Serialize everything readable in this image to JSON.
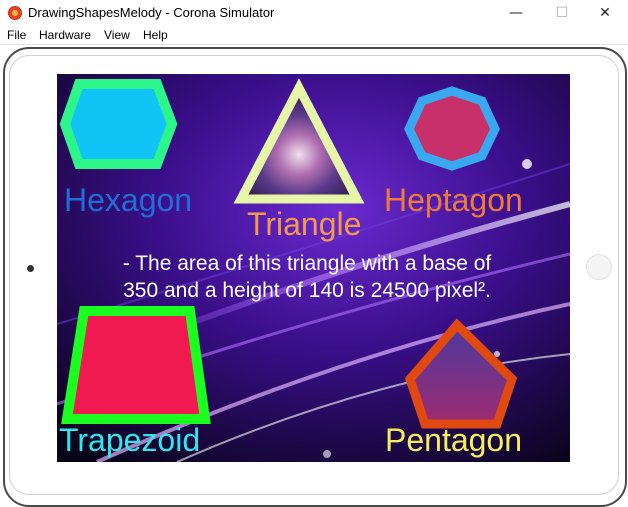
{
  "window": {
    "title": "DrawingShapesMelody - Corona Simulator",
    "controls": {
      "minimize": "—",
      "maximize": "☐",
      "close": "✕"
    }
  },
  "menu": [
    "File",
    "Hardware",
    "View",
    "Help"
  ],
  "scene": {
    "shapes": [
      {
        "name": "hexagon",
        "label": "Hexagon",
        "label_color": "#1f6fd6",
        "fill": "#12c3f5",
        "stroke": "#2cf58a"
      },
      {
        "name": "triangle",
        "label": "Triangle",
        "label_color": "#f59a4a",
        "fill": "nebula-image",
        "stroke": "#e6f5a8"
      },
      {
        "name": "heptagon",
        "label": "Heptagon",
        "label_color": "#f07a3a",
        "fill": "#c8306a",
        "stroke": "#3aa8f0"
      },
      {
        "name": "trapezoid",
        "label": "Trapezoid",
        "label_color": "#2ee8f0",
        "fill": "#f01a50",
        "stroke": "#1aff20"
      },
      {
        "name": "pentagon",
        "label": "Pentagon",
        "label_color": "#f5f05a",
        "fill": "#8a2a8a",
        "stroke": "#e04a10"
      }
    ],
    "area_text_line1": "- The area of this triangle with a base of",
    "area_text_line2": "350 and a height of 140 is 24500 pixel².",
    "background": "purple-space-light-rays"
  }
}
